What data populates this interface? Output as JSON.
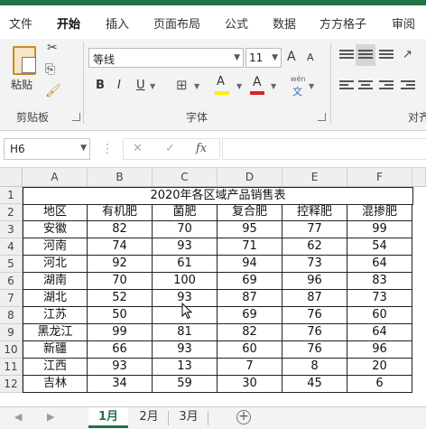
{
  "colors": {
    "accent": "#217346",
    "ribbon_bg": "#f3f3f3",
    "font_color_bar": "#e02020",
    "highlight_bar": "#ffee00"
  },
  "menu": {
    "items": [
      "文件",
      "开始",
      "插入",
      "页面布局",
      "公式",
      "数据",
      "方方格子",
      "审阅"
    ],
    "active": "开始"
  },
  "ribbon": {
    "clipboard": {
      "paste_label": "粘贴",
      "group_label": "剪贴板"
    },
    "font": {
      "font_name": "等线",
      "font_size": "11",
      "bold": "B",
      "italic": "I",
      "underline": "U",
      "grow": "A",
      "shrink": "A",
      "color_glyph": "A",
      "highlight_glyph": "A",
      "phonetic_top": "wén",
      "phonetic_bottom": "文",
      "group_label": "字体"
    },
    "alignment": {
      "group_label": "对齐"
    }
  },
  "formula_bar": {
    "name_box": "H6",
    "fx": "fx",
    "cancel": "✕",
    "enter": "✓",
    "formula": ""
  },
  "grid": {
    "columns": [
      "A",
      "B",
      "C",
      "D",
      "E",
      "F"
    ],
    "rows": [
      "1",
      "2",
      "3",
      "4",
      "5",
      "6",
      "7",
      "8",
      "9",
      "10",
      "11",
      "12"
    ],
    "title": "2020年各区域产品销售表",
    "headers": [
      "地区",
      "有机肥",
      "菌肥",
      "复合肥",
      "控释肥",
      "混掺肥"
    ],
    "data": [
      [
        "安徽",
        "82",
        "70",
        "95",
        "77",
        "99"
      ],
      [
        "河南",
        "74",
        "93",
        "71",
        "62",
        "54"
      ],
      [
        "河北",
        "92",
        "61",
        "94",
        "73",
        "64"
      ],
      [
        "湖南",
        "70",
        "100",
        "69",
        "96",
        "83"
      ],
      [
        "湖北",
        "52",
        "93",
        "87",
        "87",
        "73"
      ],
      [
        "江苏",
        "50",
        "",
        "69",
        "76",
        "60"
      ],
      [
        "黑龙江",
        "99",
        "81",
        "82",
        "76",
        "64"
      ],
      [
        "新疆",
        "66",
        "93",
        "60",
        "76",
        "96"
      ],
      [
        "江西",
        "93",
        "13",
        "7",
        "8",
        "20"
      ],
      [
        "吉林",
        "34",
        "59",
        "30",
        "45",
        "6"
      ]
    ]
  },
  "sheets": {
    "tabs": [
      "1月",
      "2月",
      "3月"
    ],
    "active": "1月",
    "add_label": "+"
  }
}
